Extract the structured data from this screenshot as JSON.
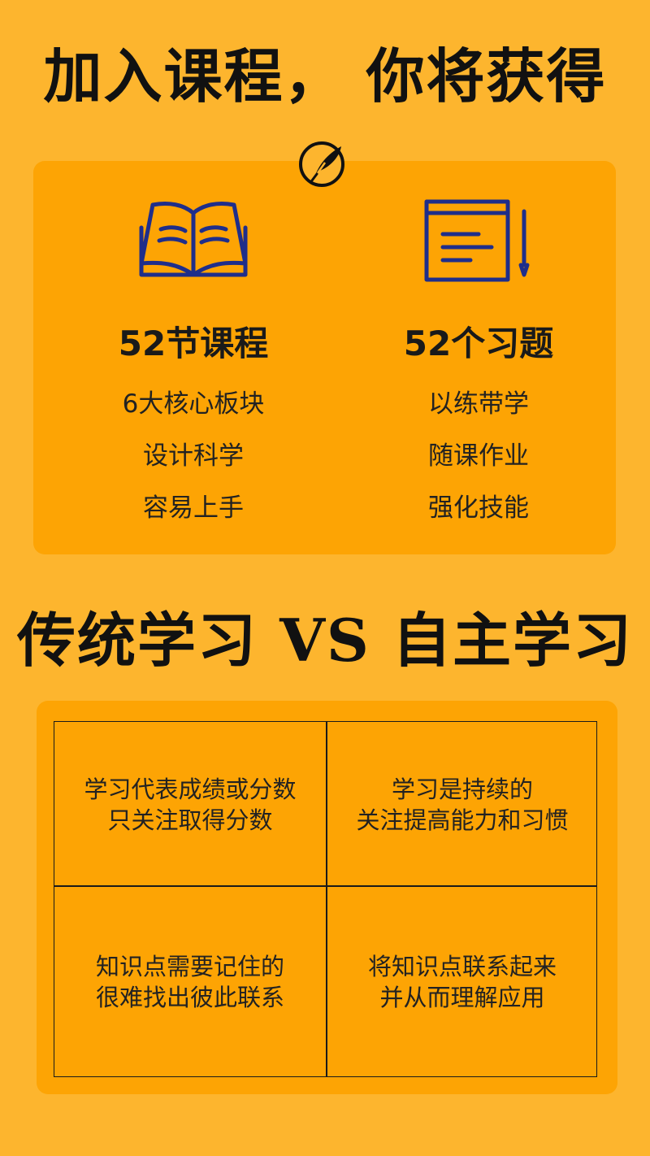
{
  "header": {
    "title": "加入课程， 你将获得"
  },
  "benefits": {
    "left": {
      "icon": "open-book-icon",
      "heading": "52节课程",
      "lines": [
        "6大核心板块",
        "设计科学",
        "容易上手"
      ]
    },
    "right": {
      "icon": "notepad-pencil-icon",
      "heading": "52个习题",
      "lines": [
        "以练带学",
        "随课作业",
        "强化技能"
      ]
    }
  },
  "comparison": {
    "title": "传统学习 VS 自主学习",
    "rows": [
      {
        "traditional": [
          "学习代表成绩或分数",
          "只关注取得分数"
        ],
        "autonomous": [
          "学习是持续的",
          "关注提高能力和习惯"
        ]
      },
      {
        "traditional": [
          "知识点需要记住的",
          "很难找出彼此联系"
        ],
        "autonomous": [
          "将知识点联系起来",
          "并从而理解应用"
        ]
      }
    ]
  },
  "colors": {
    "background": "#FDB52E",
    "card": "#FDA404",
    "icon_stroke": "#1F2E8A",
    "text": "#1a1a1a"
  }
}
